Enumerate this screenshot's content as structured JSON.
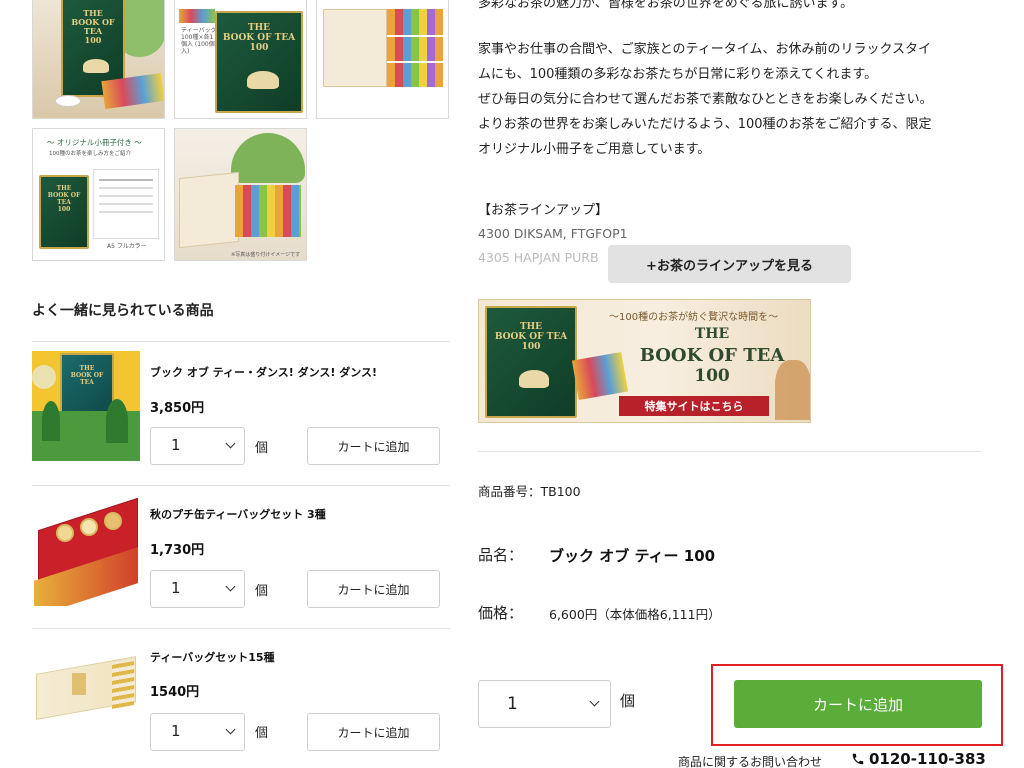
{
  "description": {
    "line1": "多彩なお茶の魅力が、皆様をお茶の世界をめぐる旅に誘います。",
    "line2": "家事やお仕事の合間や、ご家族とのティータイム、お休み前のリラックスタイ",
    "line3": "ムにも、100種類の多彩なお茶たちが日常に彩りを添えてくれます。",
    "line4": "ぜひ毎日の気分に合わせて選んだお茶で素敵なひとときをお楽しみください。",
    "line5": "よりお茶の世界をお楽しみいただけるよう、100種のお茶をご紹介する、限定",
    "line6": "オリジナル小冊子をご用意しています。"
  },
  "thumbnails": {
    "book_title_line1": "THE",
    "book_title_line2": "BOOK OF TEA",
    "book_title_line3": "100",
    "caption_teabag": "ティーバッグ 100種×各1個入 (100個入)",
    "booklet_caption": "〜 オリジナル小冊子付き 〜",
    "booklet_sub": "100種のお茶を楽しみ方をご紹介",
    "booklet_size": "A5 フルカラー",
    "photo_note": "※写真は盛り付けイメージです"
  },
  "lineup": {
    "heading": "【お茶ラインアップ】",
    "item1": "4300 DIKSAM, FTGFOP1",
    "item2": "4305 HAPJAN PURB",
    "toggle_label": "+お茶のラインアップを見る"
  },
  "banner": {
    "tagline": "〜100種のお茶が紡ぐ贅沢な時間を〜",
    "title_l1": "THE",
    "title_l2": "BOOK OF TEA",
    "title_l3": "100",
    "link_label": "特集サイトはこちら"
  },
  "related": {
    "title": "よく一緒に見られている商品",
    "unit": "個",
    "add_label": "カートに追加",
    "items": [
      {
        "name": "ブック オブ ティー・ダンス! ダンス! ダンス!",
        "price": "3,850円",
        "qty": "1"
      },
      {
        "name": "秋のプチ缶ティーバッグセット 3種",
        "price": "1,730円",
        "qty": "1"
      },
      {
        "name": "ティーバッグセット15種",
        "price": "1540円",
        "qty": "1"
      }
    ]
  },
  "product": {
    "sku_label": "商品番号：TB100",
    "name_label": "品名：",
    "name": "ブック オブ ティー 100",
    "price_label": "価格：",
    "price": "6,600円（本体価格6,111円）",
    "qty": "1",
    "unit": "個",
    "add_label": "カートに追加"
  },
  "contact": {
    "label": "商品に関するお問い合わせ",
    "phone": "0120-110-383"
  },
  "colors": {
    "cart_green": "#5aad38",
    "highlight_red": "#e02020",
    "book_green": "#1e5a3c"
  }
}
